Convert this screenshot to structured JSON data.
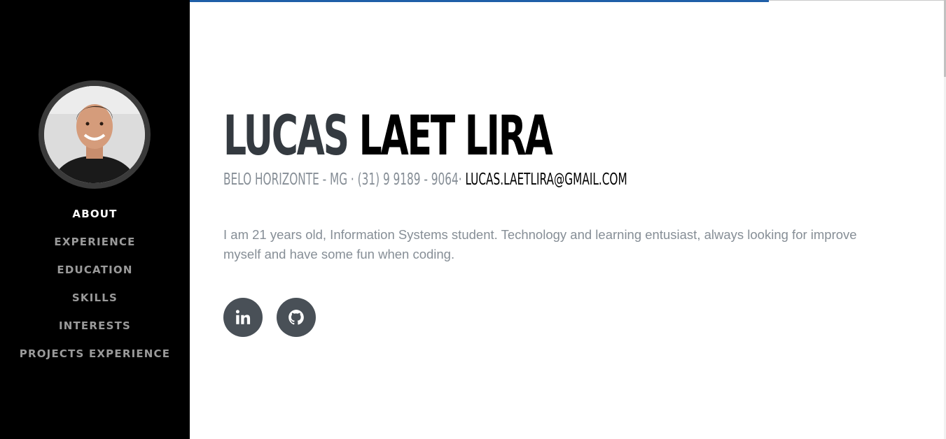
{
  "sidebar": {
    "avatar_alt": "Lucas Laet Lira",
    "nav": [
      {
        "label": "About",
        "active": true
      },
      {
        "label": "Experience",
        "active": false
      },
      {
        "label": "Education",
        "active": false
      },
      {
        "label": "Skills",
        "active": false
      },
      {
        "label": "Interests",
        "active": false
      },
      {
        "label": "Projects Experience",
        "active": false
      }
    ]
  },
  "about": {
    "first_name": "LUCAS",
    "last_name": "LAET LIRA",
    "address": "BELO HORIZONTE - MG · (31) 9 9189 - 9064·",
    "email": "LUCAS.LAETLIRA@GMAIL.COM",
    "bio": "I am 21 years old, Information Systems student. Technology and learning entusiast, always looking for improve myself and have some fun when coding."
  },
  "social": [
    {
      "icon": "linkedin-icon"
    },
    {
      "icon": "github-icon"
    }
  ],
  "colors": {
    "sidebar_bg": "#000000",
    "nav_active": "#ffffff",
    "nav_inactive": "#9a9a9a",
    "muted_text": "#868e96",
    "social_bg": "#495057"
  }
}
